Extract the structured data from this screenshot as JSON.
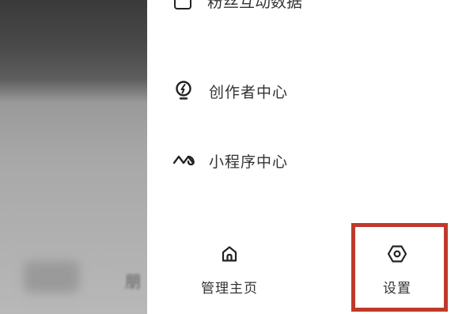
{
  "drawer": {
    "top_partial_label": "粉丝互动数据",
    "items": [
      {
        "label": "创作者中心",
        "icon": "lightbulb-icon"
      },
      {
        "label": "小程序中心",
        "icon": "mini-program-icon"
      }
    ],
    "bottom_buttons": [
      {
        "label": "管理主页",
        "icon": "home-icon"
      },
      {
        "label": "设置",
        "icon": "gear-icon"
      }
    ]
  },
  "background": {
    "partial_text": "朋"
  },
  "colors": {
    "highlight": "#c0392b",
    "text": "#333333",
    "icon": "#222222"
  }
}
